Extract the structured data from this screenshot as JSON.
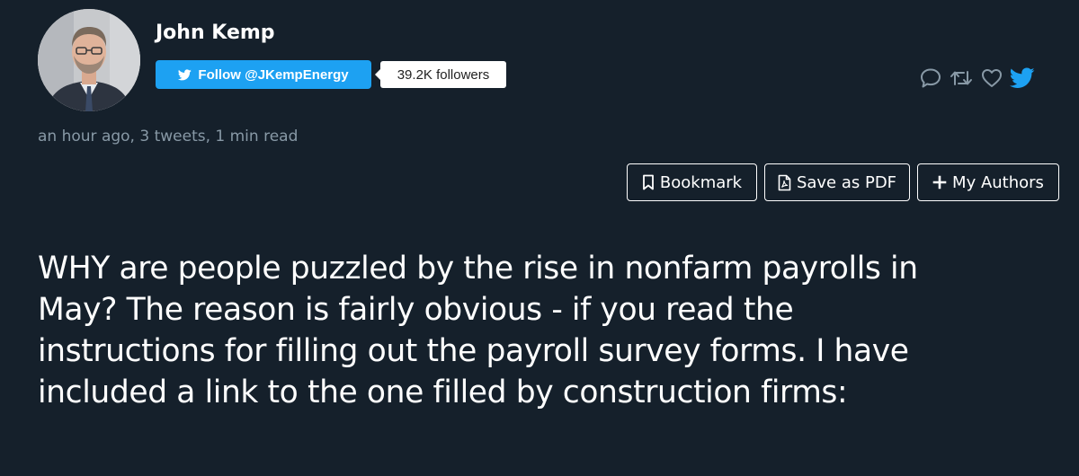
{
  "author": {
    "name": "John Kemp",
    "follow_label": "Follow @JKempEnergy",
    "followers": "39.2K followers"
  },
  "meta": "an hour ago, 3 tweets, 1 min read",
  "actions": [
    {
      "icon": "reply-icon"
    },
    {
      "icon": "retweet-icon"
    },
    {
      "icon": "like-icon"
    },
    {
      "icon": "twitter-bird-icon",
      "color": "#1da1f2"
    }
  ],
  "toolbar": {
    "bookmark_label": "Bookmark",
    "save_pdf_label": "Save as PDF",
    "my_authors_label": "My Authors"
  },
  "tweet": {
    "lines": [
      "WHY are people puzzled by the rise in nonfarm payrolls in",
      "May? The reason is fairly obvious - if you read the",
      "instructions for filling out the payroll survey forms. I have",
      "included a link to the one filled by construction firms:"
    ]
  },
  "colors": {
    "background": "#15202b",
    "accent": "#1da1f2",
    "muted": "#8899a6",
    "text": "#ffffff"
  }
}
